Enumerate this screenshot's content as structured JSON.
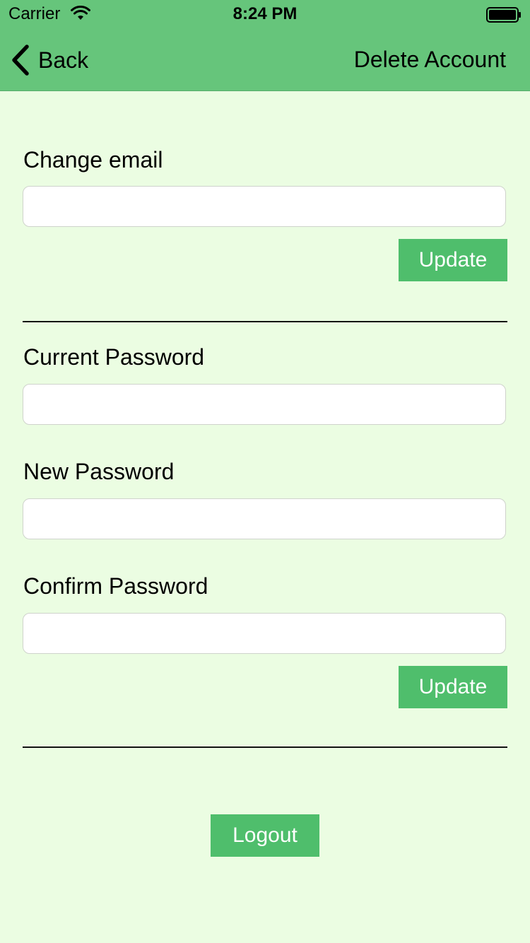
{
  "status_bar": {
    "carrier": "Carrier",
    "time": "8:24 PM"
  },
  "nav": {
    "back_label": "Back",
    "right_action": "Delete Account"
  },
  "email_section": {
    "label": "Change email",
    "input_value": "",
    "update_label": "Update"
  },
  "password_section": {
    "current_label": "Current Password",
    "current_value": "",
    "new_label": "New Password",
    "new_value": "",
    "confirm_label": "Confirm Password",
    "confirm_value": "",
    "update_label": "Update"
  },
  "logout_label": "Logout",
  "colors": {
    "nav_bar": "#66c57b",
    "background": "#ebfde2",
    "button": "#4fbe6c"
  },
  "icons": {
    "wifi": "wifi-icon",
    "battery": "battery-icon",
    "back": "chevron-left-icon"
  }
}
